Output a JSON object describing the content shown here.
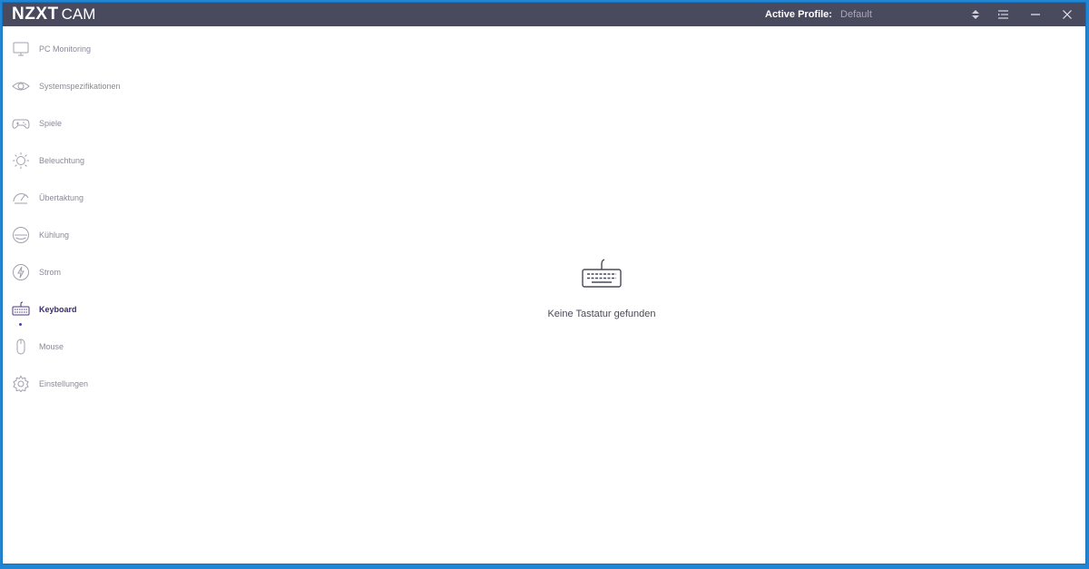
{
  "app": {
    "brand": "NZXT",
    "product": "CAM"
  },
  "header": {
    "profile_label": "Active Profile:",
    "profile_value": "Default",
    "icons": [
      "sort-icon",
      "menu-icon",
      "minimize-icon",
      "close-icon"
    ]
  },
  "sidebar": {
    "items": [
      {
        "label": "PC Monitoring",
        "icon": "monitor-icon"
      },
      {
        "label": "Systemspezifikationen",
        "icon": "eye-icon"
      },
      {
        "label": "Spiele",
        "icon": "gamepad-icon"
      },
      {
        "label": "Beleuchtung",
        "icon": "sun-icon"
      },
      {
        "label": "Übertaktung",
        "icon": "speedometer-icon"
      },
      {
        "label": "Kühlung",
        "icon": "fan-icon"
      },
      {
        "label": "Strom",
        "icon": "lightning-icon"
      },
      {
        "label": "Keyboard",
        "icon": "keyboard-icon",
        "active": true
      },
      {
        "label": "Mouse",
        "icon": "mouse-icon"
      },
      {
        "label": "Einstellungen",
        "icon": "gear-icon"
      }
    ]
  },
  "main": {
    "empty_message": "Keine Tastatur gefunden",
    "empty_icon": "keyboard-icon"
  },
  "colors": {
    "titlebar": "#4a4a5e",
    "accent": "#5b3ba8",
    "desktop": "#1f86d6"
  }
}
